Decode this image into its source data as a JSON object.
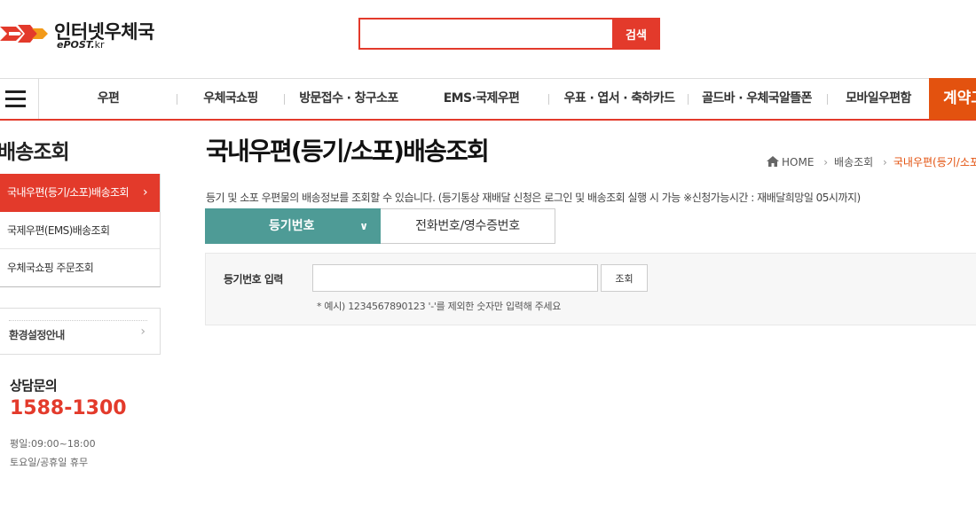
{
  "header": {
    "logo_title": "인터넷우체국",
    "logo_sub": "ePOST",
    "logo_sub_suffix": "kr",
    "search_placeholder": "",
    "search_label": "검색"
  },
  "gnb": {
    "items": [
      "우편",
      "우체국쇼핑",
      "방문접수 · 창구소포",
      "EMS·국제우편",
      "우표 · 엽서 · 축하카드",
      "골드바 · 우체국알뜰폰",
      "모바일우편함"
    ],
    "contract_label": "계약고"
  },
  "sidebar": {
    "title": "배송조회",
    "items": [
      {
        "label": "국내우편(등기/소포)배송조회",
        "active": true
      },
      {
        "label": "국제우편(EMS)배송조회",
        "active": false
      },
      {
        "label": "우체국쇼핑 주문조회",
        "active": false
      }
    ],
    "env_label": "환경설정안내",
    "cs_title": "상담문의",
    "cs_phone": "1588-1300",
    "cs_hours": "평일:09:00~18:00",
    "cs_holiday": "토요일/공휴일 휴무"
  },
  "main": {
    "title": "국내우편(등기/소포)배송조회",
    "breadcrumb": {
      "home": "HOME",
      "level1": "배송조회",
      "current": "국내우편(등기/소포)배송조회"
    },
    "description": "등기 및 소포 우편물의 배송정보를 조회할 수 있습니다. (등기통상 재배달 신청은 로그인 및 배송조회 실행 시 가능 ※신청가능시간 : 재배달희망일 05시까지)",
    "tabs": {
      "registered": "등기번호",
      "phone": "전화번호/영수증번호"
    },
    "form": {
      "label": "등기번호 입력",
      "value": "",
      "query_button": "조회",
      "hint": "* 예시) 1234567890123 '-'를 제외한 숫자만 입력해 주세요"
    }
  },
  "colors": {
    "brand_red": "#e33a2b",
    "contract_orange": "#e3520f",
    "tab_teal": "#4e9b96"
  }
}
